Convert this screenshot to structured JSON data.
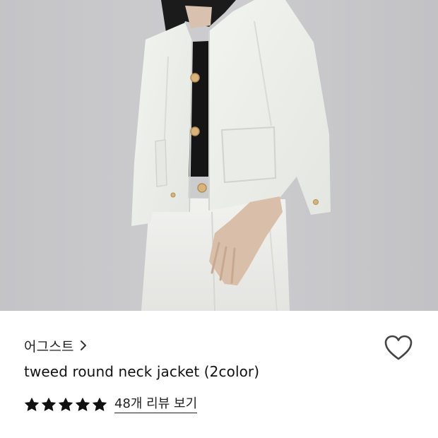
{
  "product": {
    "brand_name": "어그스트",
    "title": "tweed round neck jacket (2color)",
    "rating": 5,
    "rating_max": 5,
    "reviews_link_label": "48개 리뷰 보기"
  },
  "icons": {
    "brand_chevron": "chevron-right-icon",
    "wishlist": "heart-outline-icon",
    "star": "star-filled-icon"
  },
  "colors": {
    "text_primary": "#111111",
    "star": "#111111",
    "heart_stroke": "#444444",
    "photo_background": "#c9c9cc",
    "jacket": "#eef1ec"
  }
}
